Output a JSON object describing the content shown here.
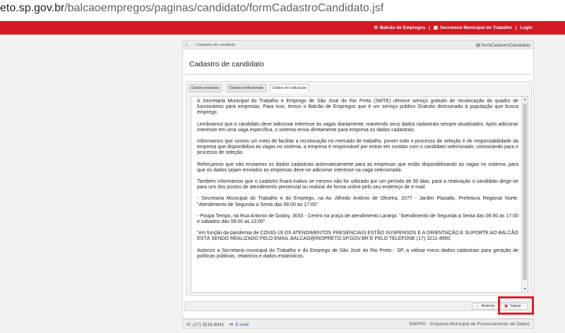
{
  "browser": {
    "url_domain": "eto.sp.gov.br",
    "url_path": "/balcaoempregos/paginas/candidato/formCadastroCandidato.jsf"
  },
  "topbar": {
    "balcao_link": "Balcão de Empregos",
    "sep1": "|",
    "secretaria_link": "Secretaria Municipal do Trabalho",
    "sep2": "|",
    "login_link": "Login"
  },
  "breadcrumb": {
    "path": "Cadastro de candidato",
    "form_name": "formCadastroCandidato"
  },
  "page_title": "Cadastro de candidato",
  "tabs": [
    {
      "label": "Dados pessoais"
    },
    {
      "label": "Dados profissionais"
    },
    {
      "label": "Dados de utilização"
    }
  ],
  "content": {
    "paragraphs": [
      "A Secretaria Municipal do Trabalho e Emprego de São José do Rio Preto (SMTE) oferece serviço gratuito de recolocação do quadro de funcionários para empresas. Para isso, temos o Balcão de Empregos que é um serviço público Gratuito direcionado à população que busca emprego.",
      "Lembramos que o candidato deve adicionar interesse às vagas diariamente, mantendo seus dados cadastrais sempre atualizados. Após adicionar interesse em uma vaga específica, o sistema envia diretamente para empresa os dados cadastrais.",
      "Informamos que somos um meio de facilitar a recolocação no mercado de trabalho, porem todo o processo de seleção é de responsabilidade da empresa que disponibiliza as vagas no sistema, a empresa é responsável por entrar em contato com o candidato selecionado, convocando para o processo de seleção.",
      "Reforçamos que não enviamos os dados cadastrais automaticamente para as empresas que estão disponibilizando as vagas no sistema, para que os dados sejam enviados as empresas deve-se adicionar interesse na vaga selecionada.",
      "Também informamos que o cadastro ficará inativo se mesmo não for utilizado por um período de 90 dias, para a reativação o candidato dirigir-se para uns dos postos de atendimento presencial ou realizar de forma online pelo seu endereço de e-mail.",
      "- Secretaria Municipal do Trabalho e do Emprego, na Av. Alfredo Antônio de Oliveira, 2077 - Jardim Planalto, Prefeitura Regional Norte. \"Atendimento de Segunda a Sexta das 08:00 as 17:00\"",
      "- Poupa Tempo, na Rua Antonio de Godoy, 3033 - Centro na praça de atendimento Laranja. \"Atendimento de Segunda a Sexta das 08:00 as 17:00 e sábados das 08:00 as 13:00\".",
      "\"em função da pandemia de COVID-19 OS ATENDIMENTOS PRESENCIAIS ESTÃO SUSPENSOS E A ORIENTAÇÃO E SUPORTE AO BALCÃO ESTÁ SENDO REALIZADO PELO EMAIL BALCAO@RIOPRETO.SP.GOV.BR E PELO TELEFONE (17) 3211-4950.",
      "Autorizo a Secretaria municipal do Trabalho e do Emprego de São José do Rio Preto - SP, a utilizar meus dados cadastrais para geração de políticas públicas, relatórios e dados estatísticos."
    ]
  },
  "buttons": {
    "previous": "Anterior",
    "save": "Salvar"
  },
  "footer": {
    "phone": "(17) 3218-8041",
    "email_label": "E-mail",
    "emp": "EMPRO - Empresa Municipal de Processamento de Dados"
  },
  "colors": {
    "brand_red": "#d31922",
    "highlight": "#e31b23",
    "link_blue": "#1a56b0"
  }
}
